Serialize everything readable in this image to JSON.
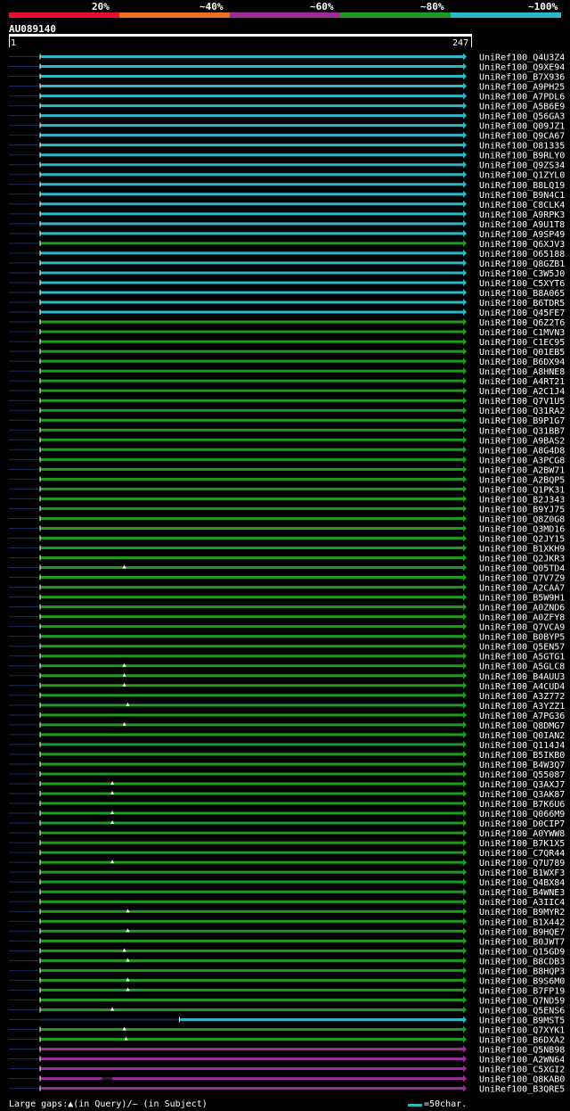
{
  "query": {
    "id": "AU089140",
    "start": "1",
    "end": "247",
    "length": 247
  },
  "identity_legend": [
    {
      "label": "20%",
      "color": "#e8102e"
    },
    {
      "label": "~40%",
      "color": "#e8731c"
    },
    {
      "label": "~60%",
      "color": "#9b2a9b"
    },
    {
      "label": "~80%",
      "color": "#1e9c1e"
    },
    {
      "label": "~100%",
      "color": "#2bb8c8"
    }
  ],
  "footer": {
    "gaps_legend": "Large gaps:▲(in Query)/— (in Subject)",
    "scale_label": "=50char."
  },
  "chart_data": {
    "type": "alignment_overview",
    "x_range": [
      1,
      247
    ],
    "hits": [
      {
        "name": "UniRef100_Q4U3Z4",
        "identity": "~100%"
      },
      {
        "name": "UniRef100_Q9XE94",
        "identity": "~100%"
      },
      {
        "name": "UniRef100_B7X936",
        "identity": "~100%"
      },
      {
        "name": "UniRef100_A9PH25",
        "identity": "~100%"
      },
      {
        "name": "UniRef100_A7PDL6",
        "identity": "~100%"
      },
      {
        "name": "UniRef100_A5B6E9",
        "identity": "~100%"
      },
      {
        "name": "UniRef100_Q56GA3",
        "identity": "~100%"
      },
      {
        "name": "UniRef100_Q09JZ1",
        "identity": "~100%"
      },
      {
        "name": "UniRef100_Q9CA67",
        "identity": "~100%"
      },
      {
        "name": "UniRef100_O81335",
        "identity": "~100%"
      },
      {
        "name": "UniRef100_B9RLY0",
        "identity": "~100%"
      },
      {
        "name": "UniRef100_Q9ZS34",
        "identity": "~100%"
      },
      {
        "name": "UniRef100_Q1ZYL0",
        "identity": "~100%"
      },
      {
        "name": "UniRef100_B8LQ19",
        "identity": "~100%"
      },
      {
        "name": "UniRef100_B9N4C1",
        "identity": "~100%"
      },
      {
        "name": "UniRef100_C8CLK4",
        "identity": "~100%"
      },
      {
        "name": "UniRef100_A9RPK3",
        "identity": "~100%"
      },
      {
        "name": "UniRef100_A9U1T8",
        "identity": "~100%"
      },
      {
        "name": "UniRef100_A9SP49",
        "identity": "~100%"
      },
      {
        "name": "UniRef100_Q6XJV3",
        "identity": "~80%"
      },
      {
        "name": "UniRef100_O65188",
        "identity": "~100%"
      },
      {
        "name": "UniRef100_Q8GZB1",
        "identity": "~100%"
      },
      {
        "name": "UniRef100_C3W5J0",
        "identity": "~100%"
      },
      {
        "name": "UniRef100_C5XYT6",
        "identity": "~100%"
      },
      {
        "name": "UniRef100_B8A065",
        "identity": "~100%"
      },
      {
        "name": "UniRef100_B6TDR5",
        "identity": "~100%"
      },
      {
        "name": "UniRef100_Q45FE7",
        "identity": "~100%"
      },
      {
        "name": "UniRef100_Q6Z2T6",
        "identity": "~80%"
      },
      {
        "name": "UniRef100_C1MVN3",
        "identity": "~80%"
      },
      {
        "name": "UniRef100_C1EC95",
        "identity": "~80%"
      },
      {
        "name": "UniRef100_Q01EB5",
        "identity": "~80%"
      },
      {
        "name": "UniRef100_B6DX94",
        "identity": "~80%"
      },
      {
        "name": "UniRef100_A8HNE8",
        "identity": "~80%"
      },
      {
        "name": "UniRef100_A4RT21",
        "identity": "~80%"
      },
      {
        "name": "UniRef100_A2C1J4",
        "identity": "~80%"
      },
      {
        "name": "UniRef100_Q7V1U5",
        "identity": "~80%"
      },
      {
        "name": "UniRef100_Q31RA2",
        "identity": "~80%"
      },
      {
        "name": "UniRef100_B9P1G7",
        "identity": "~80%"
      },
      {
        "name": "UniRef100_Q31BB7",
        "identity": "~80%"
      },
      {
        "name": "UniRef100_A9BAS2",
        "identity": "~80%"
      },
      {
        "name": "UniRef100_A8G4D8",
        "identity": "~80%"
      },
      {
        "name": "UniRef100_A3PCG8",
        "identity": "~80%"
      },
      {
        "name": "UniRef100_A2BW71",
        "identity": "~80%"
      },
      {
        "name": "UniRef100_A2BQP5",
        "identity": "~80%"
      },
      {
        "name": "UniRef100_Q1PK31",
        "identity": "~80%"
      },
      {
        "name": "UniRef100_B2J343",
        "identity": "~80%"
      },
      {
        "name": "UniRef100_B9YJ75",
        "identity": "~80%"
      },
      {
        "name": "UniRef100_Q8Z0G8",
        "identity": "~80%"
      },
      {
        "name": "UniRef100_Q3MD16",
        "identity": "~80%"
      },
      {
        "name": "UniRef100_Q2JY15",
        "identity": "~80%"
      },
      {
        "name": "UniRef100_B1XKH9",
        "identity": "~80%"
      },
      {
        "name": "UniRef100_Q2JKR3",
        "identity": "~80%"
      },
      {
        "name": "UniRef100_Q05TD4",
        "identity": "~80%",
        "query_gap": 50
      },
      {
        "name": "UniRef100_Q7V7Z9",
        "identity": "~80%"
      },
      {
        "name": "UniRef100_A2CAA7",
        "identity": "~80%"
      },
      {
        "name": "UniRef100_B5W9H1",
        "identity": "~80%"
      },
      {
        "name": "UniRef100_A0ZND6",
        "identity": "~80%"
      },
      {
        "name": "UniRef100_A0ZFY8",
        "identity": "~80%"
      },
      {
        "name": "UniRef100_Q7VCA9",
        "identity": "~80%"
      },
      {
        "name": "UniRef100_B0BYP5",
        "identity": "~80%"
      },
      {
        "name": "UniRef100_Q5EN57",
        "identity": "~80%"
      },
      {
        "name": "UniRef100_A5GTG1",
        "identity": "~80%"
      },
      {
        "name": "UniRef100_A5GLC8",
        "identity": "~80%",
        "query_gap": 50
      },
      {
        "name": "UniRef100_B4AUU3",
        "identity": "~80%",
        "query_gap": 50
      },
      {
        "name": "UniRef100_A4CUD4",
        "identity": "~80%",
        "query_gap": 50
      },
      {
        "name": "UniRef100_A3Z772",
        "identity": "~80%"
      },
      {
        "name": "UniRef100_A3YZZ1",
        "identity": "~80%",
        "query_gap": 52
      },
      {
        "name": "UniRef100_A7PG36",
        "identity": "~80%"
      },
      {
        "name": "UniRef100_Q8DMG7",
        "identity": "~80%",
        "query_gap": 50
      },
      {
        "name": "UniRef100_Q0IAN2",
        "identity": "~80%"
      },
      {
        "name": "UniRef100_Q114J4",
        "identity": "~80%"
      },
      {
        "name": "UniRef100_B5IKB0",
        "identity": "~80%"
      },
      {
        "name": "UniRef100_B4W3Q7",
        "identity": "~80%"
      },
      {
        "name": "UniRef100_Q55087",
        "identity": "~80%"
      },
      {
        "name": "UniRef100_Q3AXJ7",
        "identity": "~80%",
        "query_gap": 43
      },
      {
        "name": "UniRef100_Q3AK87",
        "identity": "~80%",
        "query_gap": 43
      },
      {
        "name": "UniRef100_B7K6U6",
        "identity": "~80%"
      },
      {
        "name": "UniRef100_Q066M9",
        "identity": "~80%",
        "query_gap": 43
      },
      {
        "name": "UniRef100_D0CIP7",
        "identity": "~80%",
        "query_gap": 43
      },
      {
        "name": "UniRef100_A0YWW8",
        "identity": "~80%"
      },
      {
        "name": "UniRef100_B7K1X5",
        "identity": "~80%"
      },
      {
        "name": "UniRef100_C7QR44",
        "identity": "~80%"
      },
      {
        "name": "UniRef100_Q7U789",
        "identity": "~80%",
        "query_gap": 43
      },
      {
        "name": "UniRef100_B1WXF3",
        "identity": "~80%"
      },
      {
        "name": "UniRef100_Q4BX84",
        "identity": "~80%"
      },
      {
        "name": "UniRef100_B4WNE3",
        "identity": "~80%"
      },
      {
        "name": "UniRef100_A3IIC4",
        "identity": "~80%"
      },
      {
        "name": "UniRef100_B9MYR2",
        "identity": "~80%",
        "query_gap": 52
      },
      {
        "name": "UniRef100_B1X442",
        "identity": "~80%"
      },
      {
        "name": "UniRef100_B9HQE7",
        "identity": "~80%",
        "query_gap": 52
      },
      {
        "name": "UniRef100_B0JWT7",
        "identity": "~80%"
      },
      {
        "name": "UniRef100_Q15GD9",
        "identity": "~80%",
        "query_gap": 50
      },
      {
        "name": "UniRef100_B8CDB3",
        "identity": "~80%",
        "query_gap": 52
      },
      {
        "name": "UniRef100_B8HQP3",
        "identity": "~80%"
      },
      {
        "name": "UniRef100_B9S6M0",
        "identity": "~80%",
        "query_gap": 52
      },
      {
        "name": "UniRef100_B7FP19",
        "identity": "~80%",
        "query_gap": 52
      },
      {
        "name": "UniRef100_Q7ND59",
        "identity": "~80%"
      },
      {
        "name": "UniRef100_Q5ENS6",
        "identity": "~80%",
        "query_gap": 43
      },
      {
        "name": "UniRef100_B9MST5",
        "identity": "~100%",
        "start": 82,
        "end": 247
      },
      {
        "name": "UniRef100_Q7XYK1",
        "identity": "~80%",
        "query_gap": 50
      },
      {
        "name": "UniRef100_B6DXA2",
        "identity": "~80%",
        "query_gap": 51
      },
      {
        "name": "UniRef100_Q5NB98",
        "identity": "~60%"
      },
      {
        "name": "UniRef100_A2WN64",
        "identity": "~60%"
      },
      {
        "name": "UniRef100_C5XGI2",
        "identity": "~60%"
      },
      {
        "name": "UniRef100_Q8KAB0",
        "identity": "~60%",
        "subject_gap": [
          37,
          43
        ]
      },
      {
        "name": "UniRef100_B3QRE5",
        "identity": "~60%"
      }
    ]
  }
}
